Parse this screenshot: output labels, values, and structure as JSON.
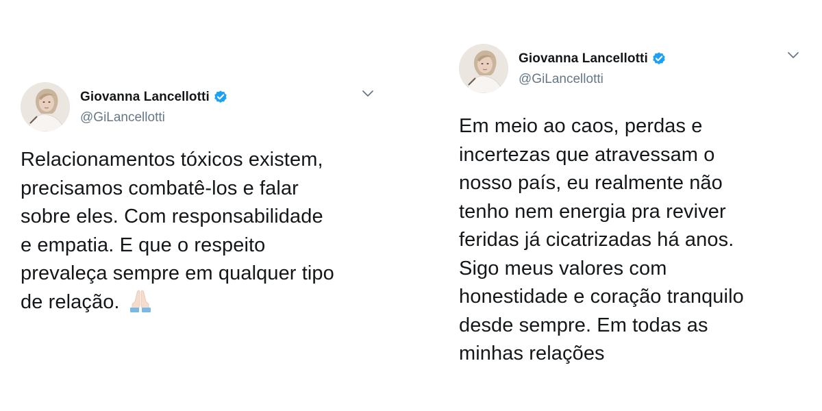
{
  "tweets": [
    {
      "author": {
        "display_name": "Giovanna Lancellotti",
        "handle": "@GiLancellotti",
        "verified": true
      },
      "text": "Relacionamentos tóxicos existem,\nprecisamos combatê-los e falar\nsobre eles. Com responsabilidade\ne empatia. E que o respeito\nprevaleça sempre em qualquer tipo\nde relação.",
      "trailing_emoji": "folded-hands-icon"
    },
    {
      "author": {
        "display_name": "Giovanna Lancellotti",
        "handle": "@GiLancellotti",
        "verified": true
      },
      "text": "Em meio ao caos, perdas e\nincertezas que atravessam o\nnosso país, eu realmente não\ntenho nem  energia pra reviver\nferidas já cicatrizadas há anos.\nSigo meus valores com\nhonestidade e coração tranquilo\ndesde sempre. Em todas as\nminhas relações"
    }
  ],
  "colors": {
    "text": "#14171a",
    "secondary_text": "#657786",
    "verified_blue": "#1da1f2",
    "background": "#ffffff"
  }
}
